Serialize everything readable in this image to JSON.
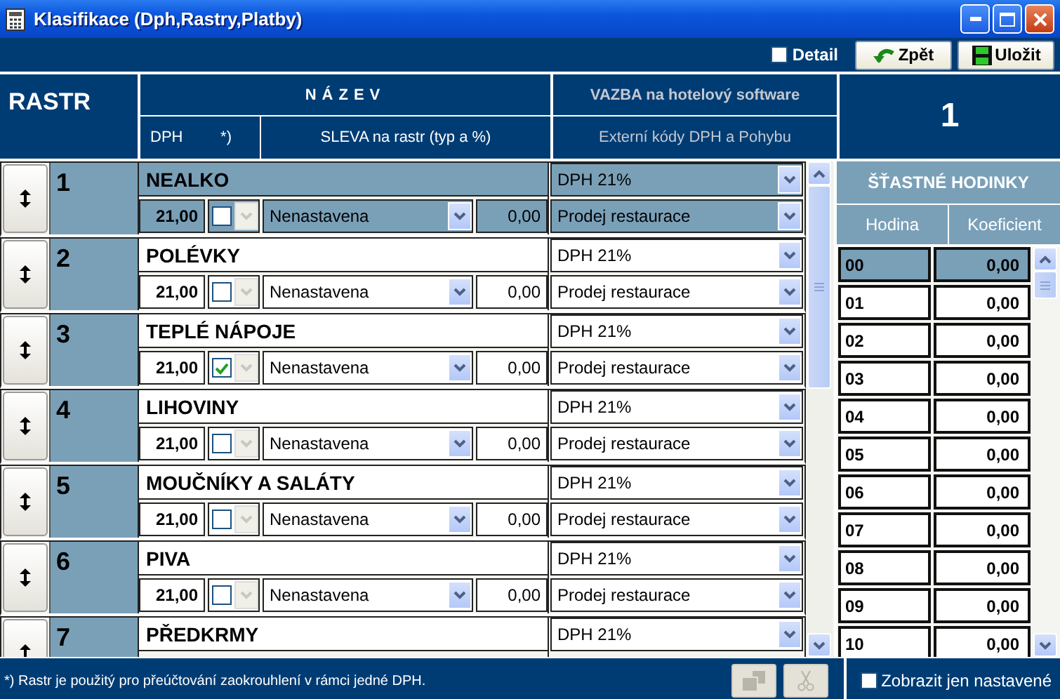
{
  "window": {
    "title": "Klasifikace (Dph,Rastry,Platby)"
  },
  "toolbar": {
    "detail": {
      "label": "Detail",
      "checked": false
    },
    "buttons": [
      {
        "label": "Zpět",
        "kind": "back"
      },
      {
        "label": "Uložit",
        "kind": "save"
      }
    ]
  },
  "header": {
    "rastr": "RASTR",
    "nazev": "NÁZEV",
    "dph": "DPH",
    "note_mark": "*)",
    "sleva": "SLEVA na rastr (typ a %)",
    "vazba": "VAZBA na hotelový software",
    "externi": "Externí kódy DPH a Pohybu"
  },
  "current_rastr": "1",
  "rastry": [
    {
      "number": "1",
      "name": "NEALKO",
      "dph": "21,00",
      "checked": false,
      "sleva_type": "Nenastavena",
      "sleva_value": "0,00",
      "vat_code": "DPH 21%",
      "movement": "Prodej restaurace",
      "selected": true
    },
    {
      "number": "2",
      "name": "POLÉVKY",
      "dph": "21,00",
      "checked": false,
      "sleva_type": "Nenastavena",
      "sleva_value": "0,00",
      "vat_code": "DPH 21%",
      "movement": "Prodej restaurace",
      "selected": false
    },
    {
      "number": "3",
      "name": "TEPLÉ NÁPOJE",
      "dph": "21,00",
      "checked": true,
      "sleva_type": "Nenastavena",
      "sleva_value": "0,00",
      "vat_code": "DPH 21%",
      "movement": "Prodej restaurace",
      "selected": false
    },
    {
      "number": "4",
      "name": "LIHOVINY",
      "dph": "21,00",
      "checked": false,
      "sleva_type": "Nenastavena",
      "sleva_value": "0,00",
      "vat_code": "DPH 21%",
      "movement": "Prodej restaurace",
      "selected": false
    },
    {
      "number": "5",
      "name": "MOUČNÍKY A SALÁTY",
      "dph": "21,00",
      "checked": false,
      "sleva_type": "Nenastavena",
      "sleva_value": "0,00",
      "vat_code": "DPH 21%",
      "movement": "Prodej restaurace",
      "selected": false
    },
    {
      "number": "6",
      "name": "PIVA",
      "dph": "21,00",
      "checked": false,
      "sleva_type": "Nenastavena",
      "sleva_value": "0,00",
      "vat_code": "DPH 21%",
      "movement": "Prodej restaurace",
      "selected": false
    },
    {
      "number": "7",
      "name": "PŘEDKRMY",
      "vat_code": "DPH 21%",
      "selected": false
    }
  ],
  "happy_hours": {
    "title": "ŠŤASTNÉ HODINKY",
    "columns": [
      "Hodina",
      "Koeficient"
    ],
    "rows": [
      {
        "hour": "00",
        "coef": "0,00",
        "selected": true
      },
      {
        "hour": "01",
        "coef": "0,00",
        "selected": false
      },
      {
        "hour": "02",
        "coef": "0,00",
        "selected": false
      },
      {
        "hour": "03",
        "coef": "0,00",
        "selected": false
      },
      {
        "hour": "04",
        "coef": "0,00",
        "selected": false
      },
      {
        "hour": "05",
        "coef": "0,00",
        "selected": false
      },
      {
        "hour": "06",
        "coef": "0,00",
        "selected": false
      },
      {
        "hour": "07",
        "coef": "0,00",
        "selected": false
      },
      {
        "hour": "08",
        "coef": "0,00",
        "selected": false
      },
      {
        "hour": "09",
        "coef": "0,00",
        "selected": false
      },
      {
        "hour": "10",
        "coef": "0,00",
        "selected": false
      }
    ]
  },
  "footer": {
    "note": "*) Rastr je použitý pro přeúčtování zaokrouhlení v rámci jedné DPH.",
    "tools": [
      {
        "kind": "paste",
        "disabled": true
      },
      {
        "kind": "cut",
        "disabled": true
      }
    ],
    "show_only_set": {
      "label": "Zobrazit jen nastavené",
      "checked": false
    }
  }
}
